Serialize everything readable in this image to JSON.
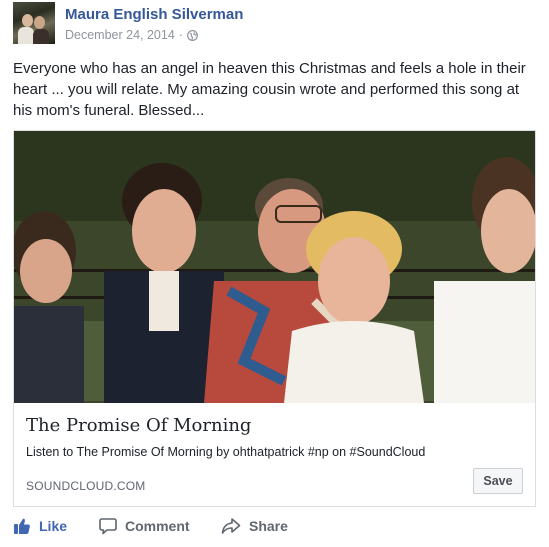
{
  "post": {
    "author": "Maura English Silverman",
    "date": "December 24, 2014",
    "separator": "·",
    "privacy_icon": "globe-icon",
    "caption": "Everyone who has an angel in heaven this Christmas and feels a hole in their heart ... you will relate. My amazing cousin wrote and performed this song at his mom's funeral. Blessed..."
  },
  "link_card": {
    "title": "The Promise Of Morning",
    "description": "Listen to The Promise Of Morning by ohthatpatrick #np on #SoundCloud",
    "domain": "SOUNDCLOUD.COM",
    "save_label": "Save"
  },
  "actions": {
    "like_label": "Like",
    "comment_label": "Comment",
    "share_label": "Share"
  },
  "colors": {
    "author_link": "#365899",
    "like_blue": "#4267b2",
    "meta_gray": "#90949c",
    "action_gray": "#606770"
  }
}
